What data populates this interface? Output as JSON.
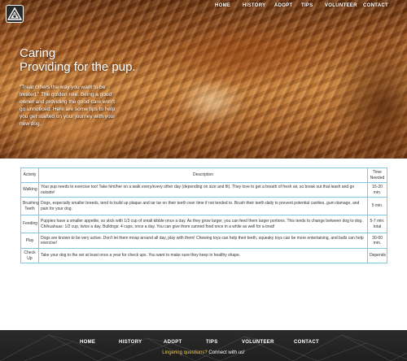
{
  "nav": {
    "items": [
      "HOME",
      "HISTORY",
      "ADOPT",
      "TIPS",
      "VOLUNTEER",
      "CONTACT"
    ]
  },
  "logo": {
    "icon": "paw-mountain-logo-icon"
  },
  "hero": {
    "title_line1": "Caring",
    "title_line2": "Providing for the pup.",
    "text": "\"Treat others the way you want to be treated.\" The golden rule. Being a good owner and providing the good care won't go unnoticed. Here are some tips to help you get started on your journey with your new dog."
  },
  "table": {
    "headers": {
      "activity": "Activity",
      "description": "Description",
      "time": "Time Needed"
    },
    "rows": [
      {
        "activity": "Walking",
        "description": "Your pup needs to exercise too! Take him/her on a walk every/every other day (depending on size and fit). They love to get a breath of fresh air, so break out that leash and go outside!",
        "time": "15-20 min."
      },
      {
        "activity": "Brushing Teeth",
        "description": "Dogs, especially smaller breeds, tend to build up plaque and tar tar on their teeth over time if not tended to. Brush their teeth daily to prevent potential cavities, gum damage, and pain for your dog.",
        "time": "5 min."
      },
      {
        "activity": "Feeding",
        "description": "Puppies have a smaller appetite, so stick with 1/3 cup of small kibble once a day. As they grow larger, you can feed them larger portions. This tends to change between dog to dog. Chihuahuas: 1/2 cup, twice a day. Bulldogs: 4 cups, once a day. You can give them canned food once in a while as well for a treat!",
        "time": "5-7 min. total"
      },
      {
        "activity": "Play",
        "description": "Dogs are known to be very active. Don't let them mosp around all day, play with them! Chewing toys can help their teeth, squeaky toys can be more entertaining, and balls can help exercise!",
        "time": "30-60 min."
      },
      {
        "activity": "Check Up",
        "description": "Take your dog to the vet at least once a year for check ups. You want to make sure they keep in healthy shape.",
        "time": "Depends"
      }
    ]
  },
  "footer": {
    "items": [
      "HOME",
      "HISTORY",
      "ADOPT",
      "TIPS",
      "VOLUNTEER",
      "CONTACT"
    ],
    "cta_prefix": "Lingering questions? ",
    "cta_link": "Connect with us!"
  },
  "colors": {
    "table_border": "#7ec8e3",
    "cta": "#f2c94c",
    "footer_bg": "#2b2b2b"
  }
}
